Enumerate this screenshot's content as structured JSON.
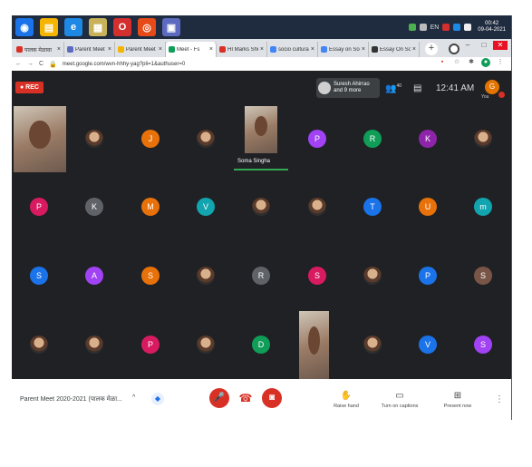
{
  "taskbar": {
    "apps": [
      {
        "icon": "chrome-icon",
        "color": "#1a73e8",
        "glyph": "◉"
      },
      {
        "icon": "file-manager-icon",
        "color": "#f4b400",
        "glyph": "▤"
      },
      {
        "icon": "ie-icon",
        "color": "#1e88e5",
        "glyph": "e"
      },
      {
        "icon": "notes-icon",
        "color": "#c9b35a",
        "glyph": "▦"
      },
      {
        "icon": "opera-icon",
        "color": "#d32f2f",
        "glyph": "O"
      },
      {
        "icon": "chrome-app-icon",
        "color": "#e64a19",
        "glyph": "◎"
      },
      {
        "icon": "window-icon",
        "color": "#5c6bc0",
        "glyph": "▣"
      }
    ],
    "lang": "EN",
    "clock_time": "00:42",
    "clock_date": "09-04-2021"
  },
  "browser": {
    "tabs": [
      {
        "label": "पालक मेळावा",
        "fav": "#d93025",
        "active": false
      },
      {
        "label": "Parent Meet 2",
        "fav": "#5c6bc0",
        "active": false
      },
      {
        "label": "Parent Meet 2",
        "fav": "#f4b400",
        "active": false
      },
      {
        "label": "Meet - Fs",
        "fav": "#0f9d58",
        "active": true
      },
      {
        "label": "HI Marks Shu",
        "fav": "#d93025",
        "active": false
      },
      {
        "label": "socio cultura",
        "fav": "#4285f4",
        "active": false
      },
      {
        "label": "Essay on Soci",
        "fav": "#4285f4",
        "active": false
      },
      {
        "label": "Essay On Soci",
        "fav": "#333333",
        "active": false
      }
    ],
    "new_tab": "+",
    "url": "meet.google.com/wvn-hhhy-yag?pli=1&authuser=0"
  },
  "meet_top": {
    "rec": "● REC",
    "presenter_name": "Suresh Ahirrao",
    "presenter_more": "and 9 more",
    "people_count": "40",
    "time": "12:41 AM",
    "you_initial": "G",
    "you_label": "You"
  },
  "grid": {
    "tiles": [
      {
        "row": 0,
        "col": 0,
        "type": "video"
      },
      {
        "row": 0,
        "col": 1,
        "type": "photo"
      },
      {
        "row": 0,
        "col": 2,
        "type": "letter",
        "letter": "J",
        "color": "#e8710a"
      },
      {
        "row": 0,
        "col": 3,
        "type": "photo"
      },
      {
        "row": 0,
        "col": 4,
        "type": "video",
        "name": "Soma Singha"
      },
      {
        "row": 0,
        "col": 5,
        "type": "letter",
        "letter": "P",
        "color": "#a142f4"
      },
      {
        "row": 0,
        "col": 6,
        "type": "letter",
        "letter": "R",
        "color": "#0f9d58"
      },
      {
        "row": 0,
        "col": 7,
        "type": "letter",
        "letter": "K",
        "color": "#8e24aa"
      },
      {
        "row": 0,
        "col": 8,
        "type": "photo"
      },
      {
        "row": 1,
        "col": 0,
        "type": "letter",
        "letter": "P",
        "color": "#d81b60"
      },
      {
        "row": 1,
        "col": 1,
        "type": "letter",
        "letter": "K",
        "color": "#5f6368"
      },
      {
        "row": 1,
        "col": 2,
        "type": "letter",
        "letter": "M",
        "color": "#e8710a"
      },
      {
        "row": 1,
        "col": 3,
        "type": "letter",
        "letter": "V",
        "color": "#12a4af"
      },
      {
        "row": 1,
        "col": 4,
        "type": "photo"
      },
      {
        "row": 1,
        "col": 5,
        "type": "photo"
      },
      {
        "row": 1,
        "col": 6,
        "type": "letter",
        "letter": "T",
        "color": "#1a73e8"
      },
      {
        "row": 1,
        "col": 7,
        "type": "letter",
        "letter": "U",
        "color": "#e8710a"
      },
      {
        "row": 1,
        "col": 8,
        "type": "letter",
        "letter": "m",
        "color": "#12a4af"
      },
      {
        "row": 2,
        "col": 0,
        "type": "letter",
        "letter": "S",
        "color": "#1a73e8"
      },
      {
        "row": 2,
        "col": 1,
        "type": "letter",
        "letter": "A",
        "color": "#a142f4"
      },
      {
        "row": 2,
        "col": 2,
        "type": "letter",
        "letter": "S",
        "color": "#e8710a"
      },
      {
        "row": 2,
        "col": 3,
        "type": "photo"
      },
      {
        "row": 2,
        "col": 4,
        "type": "letter",
        "letter": "R",
        "color": "#5f6368"
      },
      {
        "row": 2,
        "col": 5,
        "type": "letter",
        "letter": "S",
        "color": "#d81b60"
      },
      {
        "row": 2,
        "col": 6,
        "type": "photo"
      },
      {
        "row": 2,
        "col": 7,
        "type": "letter",
        "letter": "P",
        "color": "#1a73e8"
      },
      {
        "row": 2,
        "col": 8,
        "type": "letter",
        "letter": "S",
        "color": "#795548"
      },
      {
        "row": 3,
        "col": 0,
        "type": "photo"
      },
      {
        "row": 3,
        "col": 1,
        "type": "photo"
      },
      {
        "row": 3,
        "col": 2,
        "type": "letter",
        "letter": "P",
        "color": "#d81b60"
      },
      {
        "row": 3,
        "col": 3,
        "type": "photo"
      },
      {
        "row": 3,
        "col": 4,
        "type": "letter",
        "letter": "D",
        "color": "#0f9d58"
      },
      {
        "row": 3,
        "col": 5,
        "type": "video"
      },
      {
        "row": 3,
        "col": 6,
        "type": "photo"
      },
      {
        "row": 3,
        "col": 7,
        "type": "letter",
        "letter": "V",
        "color": "#1a73e8"
      },
      {
        "row": 3,
        "col": 8,
        "type": "letter",
        "letter": "S",
        "color": "#a142f4"
      }
    ]
  },
  "bottom": {
    "meeting_title": "Parent Meet 2020-2021 (पालक मेळा...",
    "raise_hand": "Raise hand",
    "captions": "Turn on captions",
    "present": "Present now"
  }
}
